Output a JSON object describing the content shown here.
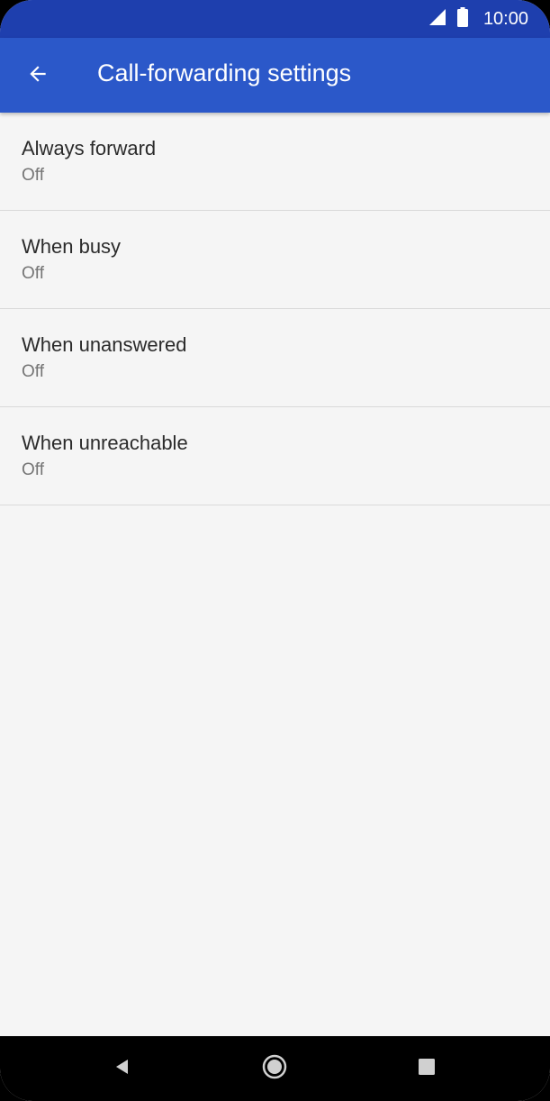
{
  "status_bar": {
    "time": "10:00",
    "icons": [
      "signal-icon",
      "battery-icon"
    ]
  },
  "app_bar": {
    "back_icon": "arrow-left-icon",
    "title": "Call-forwarding settings"
  },
  "items": [
    {
      "title": "Always forward",
      "status": "Off"
    },
    {
      "title": "When busy",
      "status": "Off"
    },
    {
      "title": "When unanswered",
      "status": "Off"
    },
    {
      "title": "When unreachable",
      "status": "Off"
    }
  ],
  "nav_bar": {
    "buttons": [
      "back-triangle-icon",
      "home-circle-icon",
      "recents-square-icon"
    ]
  },
  "colors": {
    "status_bar": "#1e3fae",
    "app_bar": "#2b58c9",
    "background": "#f5f5f5"
  }
}
